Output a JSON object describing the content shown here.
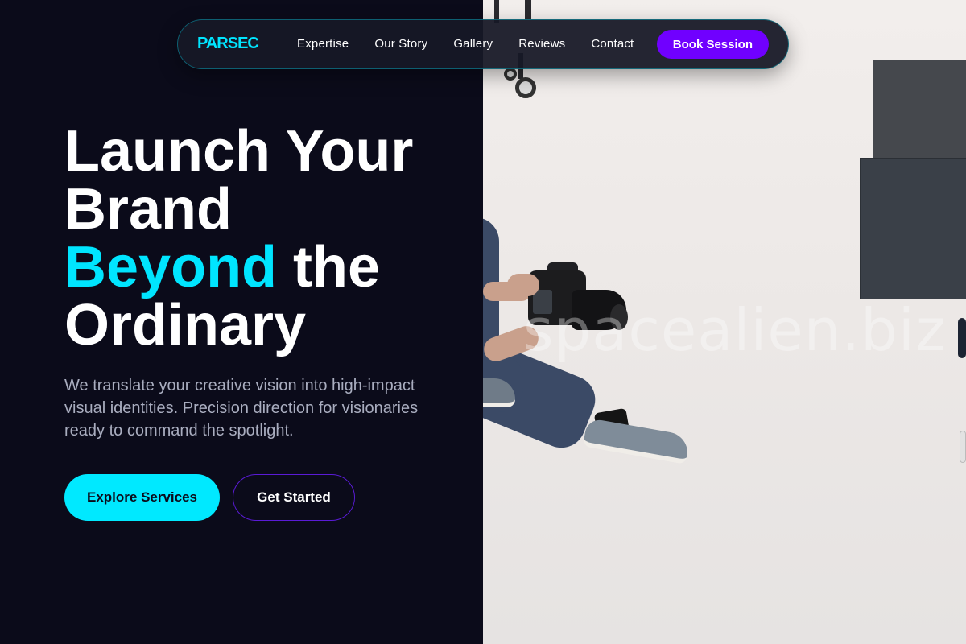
{
  "nav": {
    "logo": "PARSEC",
    "links": [
      "Expertise",
      "Our Story",
      "Gallery",
      "Reviews",
      "Contact"
    ],
    "cta": "Book Session"
  },
  "hero": {
    "headline_line1": "Launch Your Brand",
    "headline_accent": "Beyond",
    "headline_rest": " the Ordinary",
    "subtitle": "We translate your creative vision into high-impact visual identities. Precision direction for visionaries ready to command the spotlight.",
    "primary_cta": "Explore Services",
    "secondary_cta": "Get Started"
  },
  "image": {
    "watermark": "spacealien.biz",
    "subject": "photographer-with-camera"
  },
  "colors": {
    "background": "#0b0b1a",
    "accent_cyan": "#00e5ff",
    "accent_purple": "#7000ff"
  }
}
